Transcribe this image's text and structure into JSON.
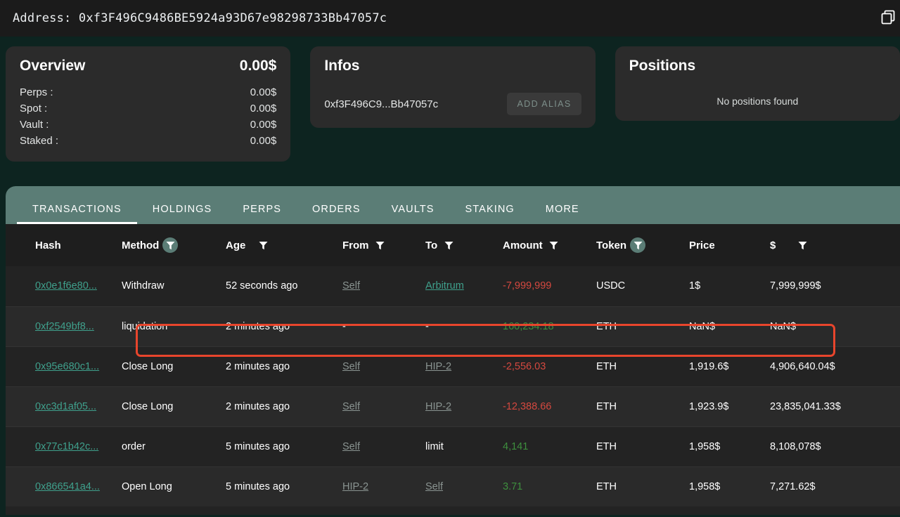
{
  "address_bar": {
    "label": "Address:",
    "value": "0xf3F496C9486BE5924a93D67e98298733Bb47057c",
    "copy_icon": "copy-icon"
  },
  "overview": {
    "title": "Overview",
    "total": "0.00$",
    "rows": [
      {
        "label": "Perps :",
        "value": "0.00$"
      },
      {
        "label": "Spot :",
        "value": "0.00$"
      },
      {
        "label": "Vault :",
        "value": "0.00$"
      },
      {
        "label": "Staked :",
        "value": "0.00$"
      }
    ]
  },
  "infos": {
    "title": "Infos",
    "address_short": "0xf3F496C9...Bb47057c",
    "add_alias_label": "ADD ALIAS"
  },
  "positions": {
    "title": "Positions",
    "empty_text": "No positions found"
  },
  "tabs": [
    {
      "label": "TRANSACTIONS",
      "active": true
    },
    {
      "label": "HOLDINGS",
      "active": false
    },
    {
      "label": "PERPS",
      "active": false
    },
    {
      "label": "ORDERS",
      "active": false
    },
    {
      "label": "VAULTS",
      "active": false
    },
    {
      "label": "STAKING",
      "active": false
    },
    {
      "label": "MORE",
      "active": false
    }
  ],
  "table": {
    "columns": [
      {
        "label": "Hash",
        "filter": "none"
      },
      {
        "label": "Method",
        "filter": "active"
      },
      {
        "label": "Age",
        "filter": "plain"
      },
      {
        "label": "From",
        "filter": "plain"
      },
      {
        "label": "To",
        "filter": "plain"
      },
      {
        "label": "Amount",
        "filter": "plain"
      },
      {
        "label": "Token",
        "filter": "active"
      },
      {
        "label": "Price",
        "filter": "none"
      },
      {
        "label": "$",
        "filter": "plain"
      }
    ],
    "rows": [
      {
        "hash": "0x0e1f6e80...",
        "method": "Withdraw",
        "age": "52 seconds ago",
        "from": "Self",
        "from_style": "link-muted",
        "to": "Arbitrum",
        "to_style": "link-teal",
        "amount": "-7,999,999",
        "amount_style": "neg",
        "token": "USDC",
        "price": "1$",
        "usd": "7,999,999$",
        "highlighted": false
      },
      {
        "hash": "0xf2549bf8...",
        "method": "liquidation",
        "age": "2 minutes ago",
        "from": "-",
        "from_style": "plain",
        "to": "-",
        "to_style": "plain",
        "amount": "160,234.18",
        "amount_style": "pos",
        "token": "ETH",
        "price": "NaN$",
        "usd": "NaN$",
        "highlighted": true
      },
      {
        "hash": "0x95e680c1...",
        "method": "Close Long",
        "age": "2 minutes ago",
        "from": "Self",
        "from_style": "link-muted",
        "to": "HIP-2",
        "to_style": "link-muted",
        "amount": "-2,556.03",
        "amount_style": "neg",
        "token": "ETH",
        "price": "1,919.6$",
        "usd": "4,906,640.04$",
        "highlighted": false
      },
      {
        "hash": "0xc3d1af05...",
        "method": "Close Long",
        "age": "2 minutes ago",
        "from": "Self",
        "from_style": "link-muted",
        "to": "HIP-2",
        "to_style": "link-muted",
        "amount": "-12,388.66",
        "amount_style": "neg",
        "token": "ETH",
        "price": "1,923.9$",
        "usd": "23,835,041.33$",
        "highlighted": false
      },
      {
        "hash": "0x77c1b42c...",
        "method": "order",
        "age": "5 minutes ago",
        "from": "Self",
        "from_style": "link-muted",
        "to": "limit",
        "to_style": "plain",
        "amount": "4,141",
        "amount_style": "pos",
        "token": "ETH",
        "price": "1,958$",
        "usd": "8,108,078$",
        "highlighted": false
      },
      {
        "hash": "0x866541a4...",
        "method": "Open Long",
        "age": "5 minutes ago",
        "from": "HIP-2",
        "from_style": "link-muted",
        "to": "Self",
        "to_style": "link-muted",
        "amount": "3.71",
        "amount_style": "pos",
        "token": "ETH",
        "price": "1,958$",
        "usd": "7,271.62$",
        "highlighted": false
      }
    ]
  },
  "colors": {
    "page_bg": "#0d2420",
    "card_bg": "#2b2b2b",
    "tabbar_bg": "#5b7d76",
    "accent_link": "#3fa08c",
    "negative": "#d4483f",
    "positive": "#3e8f3e",
    "highlight_border": "#e8452c"
  }
}
